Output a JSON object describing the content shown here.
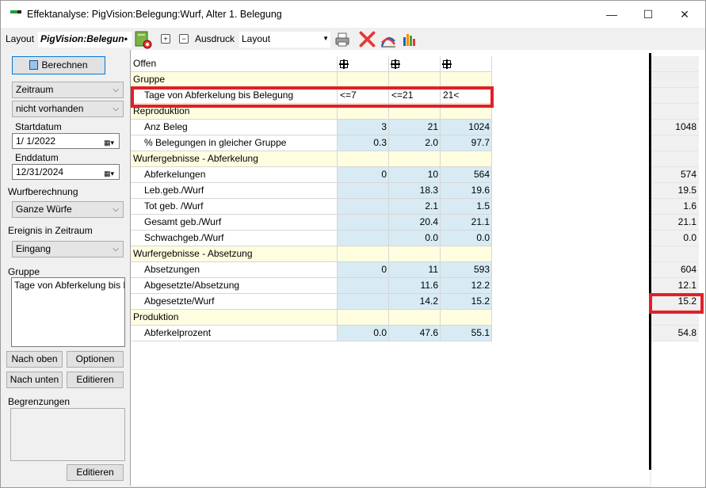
{
  "window": {
    "title": "Effektanalyse: PigVision:Belegung:Wurf, Alter 1. Belegung",
    "minimize": "—",
    "maximize": "☐",
    "close": "✕"
  },
  "toolbar": {
    "layout_label": "Layout",
    "layout_value": "PigVision:Belegun•",
    "expand_symbol": "+",
    "collapse_symbol": "−",
    "ausdruck_label": "Ausdruck",
    "ausdruck_value": "Layout",
    "icons": [
      "report-settings-icon",
      "print-icon",
      "delete-icon",
      "curve-chart-icon",
      "bar-chart-icon"
    ]
  },
  "left": {
    "berechnen": "Berechnen",
    "zeitraum": "Zeitraum",
    "nicht_vorhanden": "nicht vorhanden",
    "startdatum_label": "Startdatum",
    "startdatum": "1/  1/2022",
    "enddatum_label": "Enddatum",
    "enddatum": "12/31/2024",
    "wurfberechnung_label": "Wurfberechnung",
    "wurfberechnung": "Ganze Würfe",
    "ereignis_label": "Ereignis in Zeitraum",
    "ereignis": "Eingang",
    "gruppe_label": "Gruppe",
    "gruppe_item": "Tage von Abferkelung bis Be",
    "nach_oben": "Nach oben",
    "optionen": "Optionen",
    "nach_unten": "Nach unten",
    "editieren1": "Editieren",
    "begrenzungen_label": "Begrenzungen",
    "editieren2": "Editieren"
  },
  "grid": {
    "rows": [
      {
        "kind": "header",
        "label": "Offen"
      },
      {
        "kind": "section",
        "label": "Gruppe"
      },
      {
        "kind": "group",
        "label": "Tage von Abferkelung bis Belegung",
        "v1": "<=7",
        "v2": "<=21",
        "v3": "21<"
      },
      {
        "kind": "section",
        "label": "Reproduktion"
      },
      {
        "kind": "data",
        "label": "Anz Beleg",
        "v1": "3",
        "v2": "21",
        "v3": "1024"
      },
      {
        "kind": "data",
        "label": "% Belegungen in gleicher Gruppe",
        "v1": "0.3",
        "v2": "2.0",
        "v3": "97.7"
      },
      {
        "kind": "section",
        "label": "Wurfergebnisse - Abferkelung"
      },
      {
        "kind": "data",
        "label": "Abferkelungen",
        "v1": "0",
        "v2": "10",
        "v3": "564"
      },
      {
        "kind": "data",
        "label": "Leb.geb./Wurf",
        "v1": "",
        "v2": "18.3",
        "v3": "19.6"
      },
      {
        "kind": "data",
        "label": "Tot geb. /Wurf",
        "v1": "",
        "v2": "2.1",
        "v3": "1.5"
      },
      {
        "kind": "data",
        "label": "Gesamt geb./Wurf",
        "v1": "",
        "v2": "20.4",
        "v3": "21.1"
      },
      {
        "kind": "data",
        "label": "Schwachgeb./Wurf",
        "v1": "",
        "v2": "0.0",
        "v3": "0.0"
      },
      {
        "kind": "section",
        "label": "Wurfergebnisse - Absetzung"
      },
      {
        "kind": "data",
        "label": "Absetzungen",
        "v1": "0",
        "v2": "11",
        "v3": "593"
      },
      {
        "kind": "data",
        "label": "Abgesetzte/Absetzung",
        "v1": "",
        "v2": "11.6",
        "v3": "12.2"
      },
      {
        "kind": "data",
        "label": "Abgesetzte/Wurf",
        "v1": "",
        "v2": "14.2",
        "v3": "15.2"
      },
      {
        "kind": "section",
        "label": "Produktion"
      },
      {
        "kind": "data",
        "label": "Abferkelprozent",
        "v1": "0.0",
        "v2": "47.6",
        "v3": "55.1"
      }
    ],
    "totals": [
      "",
      "",
      "",
      "",
      "1048",
      "",
      "",
      "574",
      "19.5",
      "1.6",
      "21.1",
      "0.0",
      "",
      "604",
      "12.1",
      "15.2",
      "",
      "54.8"
    ]
  }
}
